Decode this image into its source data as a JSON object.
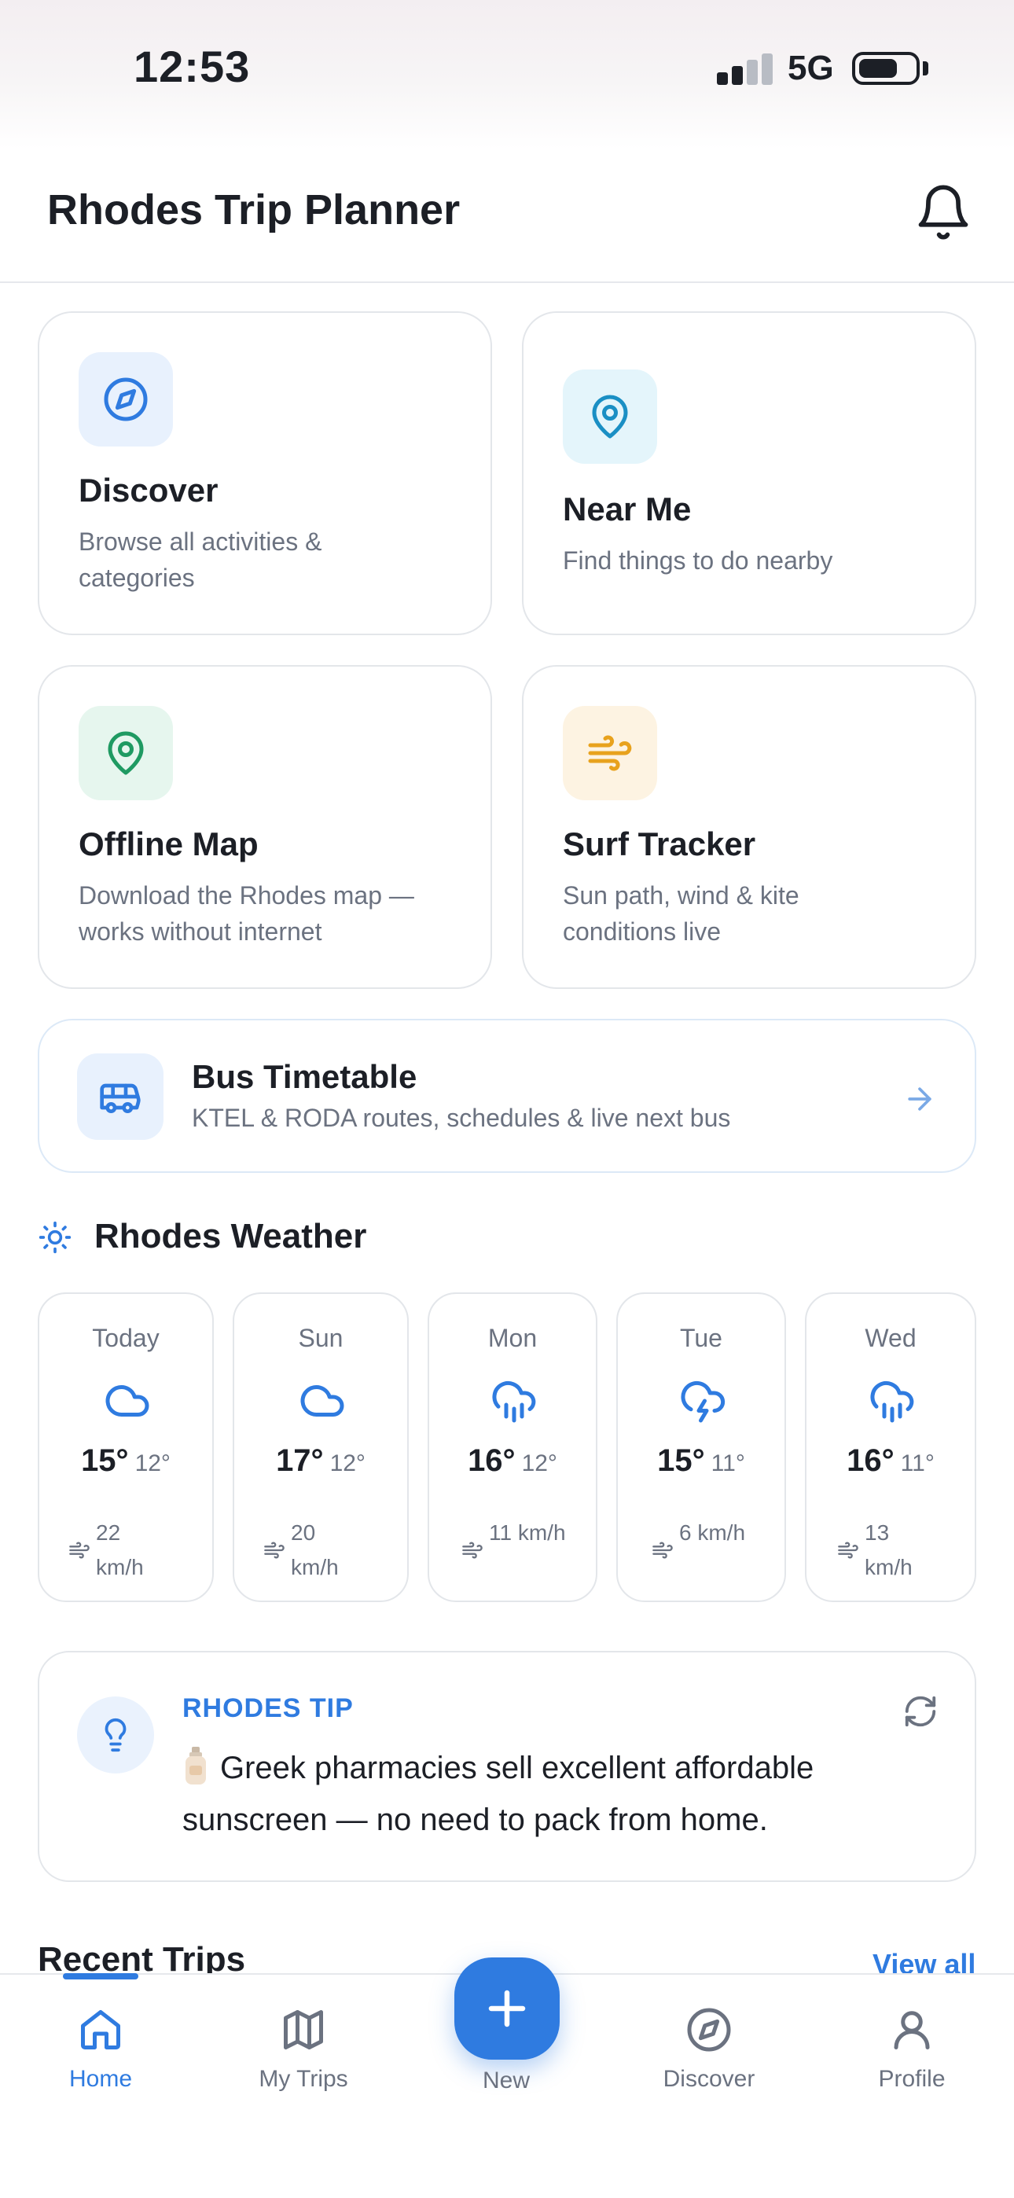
{
  "status_bar": {
    "time": "12:53",
    "network": "5G"
  },
  "header": {
    "title": "Rhodes Trip Planner",
    "icon": "bell-icon"
  },
  "features": [
    {
      "id": "discover",
      "title": "Discover",
      "description_lines": [
        "Browse all activities &",
        "categories"
      ],
      "icon": "compass-icon",
      "tile_color": "#e8f1fd",
      "accent": "#2f7be0"
    },
    {
      "id": "near-me",
      "title": "Near Me",
      "description_lines": [
        "Find things to do nearby"
      ],
      "icon": "map-pin-icon",
      "tile_color": "#e4f5fb",
      "accent": "#1a8fc4"
    },
    {
      "id": "offline-map",
      "title": "Offline Map",
      "description_lines": [
        "Download the Rhodes map —",
        "works without internet"
      ],
      "icon": "map-pin-icon",
      "tile_color": "#e6f6ee",
      "accent": "#1f9a62"
    },
    {
      "id": "surf-tracker",
      "title": "Surf Tracker",
      "description_lines": [
        "Sun path, wind & kite",
        "conditions live"
      ],
      "icon": "wind-icon",
      "tile_color": "#fdf3e2",
      "accent": "#e8a21d"
    }
  ],
  "bus": {
    "title": "Bus Timetable",
    "description": "KTEL & RODA routes, schedules & live next bus",
    "icon": "bus-icon",
    "tile_color": "#e8f1fd",
    "accent": "#2f7be0"
  },
  "weather": {
    "title": "Rhodes Weather",
    "icon": "sun-icon",
    "days": [
      {
        "day": "Today",
        "icon": "cloud-icon",
        "high": "15°",
        "low": "12°",
        "wind_lines": [
          "22",
          "km/h"
        ]
      },
      {
        "day": "Sun",
        "icon": "cloud-icon",
        "high": "17°",
        "low": "12°",
        "wind_lines": [
          "20",
          "km/h"
        ]
      },
      {
        "day": "Mon",
        "icon": "cloud-rain-icon",
        "high": "16°",
        "low": "12°",
        "wind_lines": [
          "11 km/h"
        ]
      },
      {
        "day": "Tue",
        "icon": "cloud-lightning-icon",
        "high": "15°",
        "low": "11°",
        "wind_lines": [
          "6 km/h"
        ]
      },
      {
        "day": "Wed",
        "icon": "cloud-rain-icon",
        "high": "16°",
        "low": "11°",
        "wind_lines": [
          "13",
          "km/h"
        ]
      }
    ]
  },
  "tip": {
    "label": "RHODES TIP",
    "emoji": "lotion-bottle-icon",
    "text_lines": [
      "Greek pharmacies sell excellent affordable",
      "sunscreen — no need to pack from home."
    ]
  },
  "recent": {
    "title": "Recent Trips",
    "view_all": "View all"
  },
  "tabs": [
    {
      "id": "home",
      "label": "Home",
      "icon": "home-icon",
      "active": true
    },
    {
      "id": "my-trips",
      "label": "My Trips",
      "icon": "map-icon",
      "active": false
    },
    {
      "id": "new",
      "label": "New",
      "icon": "plus-icon",
      "active": false
    },
    {
      "id": "discover",
      "label": "Discover",
      "icon": "compass-icon",
      "active": false
    },
    {
      "id": "profile",
      "label": "Profile",
      "icon": "user-icon",
      "active": false
    }
  ],
  "colors": {
    "accent": "#2f7be0",
    "text": "#1c1f26",
    "muted": "#6b7280",
    "border": "#e3e6ea"
  }
}
